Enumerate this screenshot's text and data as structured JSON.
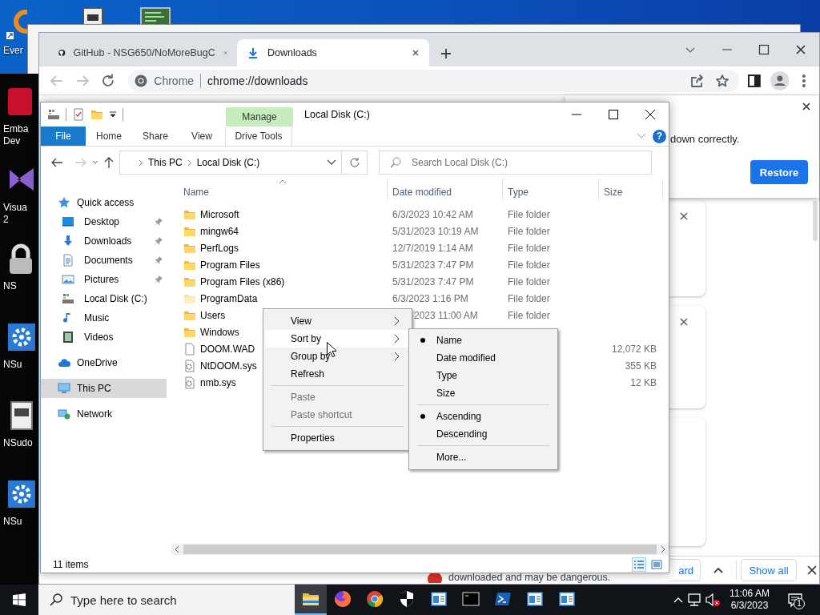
{
  "desktop": {
    "icons": [
      {
        "lines": [
          "Ever"
        ]
      },
      {
        "lines": [
          "Emba",
          "Dev"
        ]
      },
      {
        "lines": [
          "Visua",
          "2"
        ]
      },
      {
        "lines": [
          "NS"
        ]
      },
      {
        "lines": [
          "NSu"
        ]
      },
      {
        "lines": [
          "NSudo"
        ]
      },
      {
        "lines": [
          "NSu"
        ]
      }
    ]
  },
  "browser": {
    "tabs": [
      {
        "title": "GitHub - NSG650/NoMoreBugC",
        "selected": false
      },
      {
        "title": "Downloads",
        "selected": true
      }
    ],
    "omnibox": {
      "chip": "Chrome",
      "url": "chrome://downloads"
    },
    "restore_bubble": {
      "message": "down correctly.",
      "button": "Restore"
    },
    "download_cards": [
      {
        "closable": true
      },
      {
        "closable": true
      },
      {
        "closable": false
      }
    ],
    "shelf": {
      "warning": "downloaded and may be dangerous.",
      "discard_button": "ard",
      "show_all_button": "Show all"
    }
  },
  "explorer": {
    "context_group": "Manage",
    "title": "Local Disk (C:)",
    "ribbon_tabs": [
      {
        "label": "File",
        "kind": "file"
      },
      {
        "label": "Home",
        "kind": "tab"
      },
      {
        "label": "Share",
        "kind": "tab"
      },
      {
        "label": "View",
        "kind": "tab"
      },
      {
        "label": "Drive Tools",
        "kind": "context"
      }
    ],
    "help_button": "?",
    "breadcrumb": [
      "This PC",
      "Local Disk (C:)"
    ],
    "search": {
      "placeholder": "Search Local Disk (C:)"
    },
    "nav": [
      {
        "label": "Quick access",
        "kind": "star",
        "selected": false,
        "children": [
          {
            "label": "Desktop",
            "kind": "desktop",
            "pinned": true,
            "selected": false
          },
          {
            "label": "Downloads",
            "kind": "downloads",
            "pinned": true,
            "selected": false
          },
          {
            "label": "Documents",
            "kind": "documents",
            "pinned": true,
            "selected": false
          },
          {
            "label": "Pictures",
            "kind": "pictures",
            "pinned": true,
            "selected": false
          },
          {
            "label": "Local Disk (C:)",
            "kind": "drive",
            "pinned": false,
            "selected": false
          },
          {
            "label": "Music",
            "kind": "music",
            "pinned": false,
            "selected": false
          },
          {
            "label": "Videos",
            "kind": "videos",
            "pinned": false,
            "selected": false
          }
        ]
      },
      {
        "label": "OneDrive",
        "kind": "cloud",
        "selected": false
      },
      {
        "label": "This PC",
        "kind": "pc",
        "selected": true
      },
      {
        "label": "Network",
        "kind": "network",
        "selected": false
      }
    ],
    "columns": [
      {
        "label": "Name",
        "sorted": true
      },
      {
        "label": "Date modified",
        "sorted": false
      },
      {
        "label": "Type",
        "sorted": false
      },
      {
        "label": "Size",
        "sorted": false
      }
    ],
    "rows": [
      {
        "name": "Microsoft",
        "kind": "folder",
        "date": "6/3/2023 10:42 AM",
        "type": "File folder"
      },
      {
        "name": "mingw64",
        "kind": "folder",
        "date": "5/31/2023 10:19 AM",
        "type": "File folder"
      },
      {
        "name": "PerfLogs",
        "kind": "folder",
        "date": "12/7/2019 1:14 AM",
        "type": "File folder"
      },
      {
        "name": "Program Files",
        "kind": "folder",
        "date": "5/31/2023 7:47 PM",
        "type": "File folder"
      },
      {
        "name": "Program Files (x86)",
        "kind": "folder",
        "date": "5/31/2023 7:47 PM",
        "type": "File folder"
      },
      {
        "name": "ProgramData",
        "kind": "hidden-folder",
        "date": "6/3/2023 1:16 PM",
        "type": "File folder"
      },
      {
        "name": "Users",
        "kind": "folder",
        "date": "2023 11:00 AM",
        "type": "File folder"
      },
      {
        "name": "Windows",
        "kind": "folder"
      },
      {
        "name": "DOOM.WAD",
        "kind": "file",
        "size": "12,072 KB"
      },
      {
        "name": "NtDOOM.sys",
        "kind": "system",
        "size": "355 KB"
      },
      {
        "name": "nmb.sys",
        "kind": "system",
        "size": "12 KB"
      }
    ],
    "status": "11 items",
    "view_buttons": [
      {
        "selected": true
      },
      {
        "selected": false
      }
    ]
  },
  "context_menu": {
    "items": [
      {
        "label": "View",
        "kind": "submenu",
        "selected": false,
        "disabled": false
      },
      {
        "label": "Sort by",
        "kind": "submenu",
        "selected": true,
        "disabled": false
      },
      {
        "label": "Group by",
        "kind": "submenu",
        "selected": false,
        "disabled": false
      },
      {
        "label": "Refresh",
        "kind": "command",
        "selected": false,
        "disabled": false
      },
      {
        "kind": "separator"
      },
      {
        "label": "Paste",
        "kind": "command",
        "selected": false,
        "disabled": true
      },
      {
        "label": "Paste shortcut",
        "kind": "command",
        "selected": false,
        "disabled": true
      },
      {
        "kind": "separator"
      },
      {
        "label": "Properties",
        "kind": "command",
        "selected": false,
        "disabled": false
      }
    ]
  },
  "sort_menu": {
    "items": [
      {
        "label": "Name",
        "kind": "radio",
        "checked": true
      },
      {
        "label": "Date modified",
        "kind": "radio",
        "checked": false
      },
      {
        "label": "Type",
        "kind": "radio",
        "checked": false
      },
      {
        "label": "Size",
        "kind": "radio",
        "checked": false
      },
      {
        "kind": "separator"
      },
      {
        "label": "Ascending",
        "kind": "radio",
        "checked": true
      },
      {
        "label": "Descending",
        "kind": "radio",
        "checked": false
      },
      {
        "kind": "separator"
      },
      {
        "label": "More...",
        "kind": "command"
      }
    ]
  },
  "taskbar": {
    "search_placeholder": "Type here to search",
    "apps": [
      {
        "kind": "folder",
        "active": true
      },
      {
        "kind": "fox",
        "active": false
      },
      {
        "kind": "chrome",
        "active": false
      },
      {
        "kind": "shield",
        "active": false
      },
      {
        "kind": "window",
        "active": false
      },
      {
        "kind": "terminal",
        "active": false
      },
      {
        "kind": "shell",
        "active": false
      },
      {
        "kind": "window",
        "active": false
      },
      {
        "kind": "window",
        "active": false
      }
    ],
    "clock": {
      "time": "11:06 AM",
      "date": "6/3/2023"
    },
    "notification_count": "1"
  }
}
